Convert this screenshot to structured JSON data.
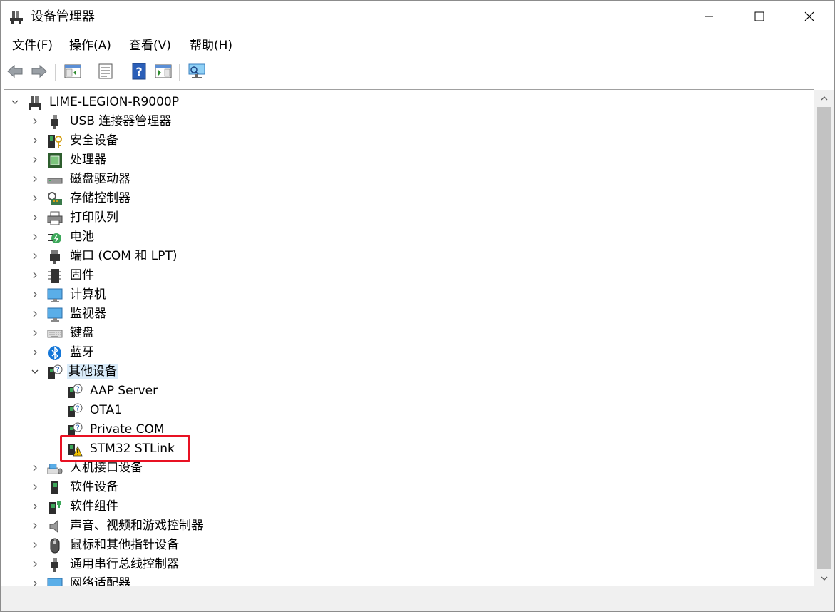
{
  "window": {
    "title": "设备管理器",
    "minimize_icon": "minimize-icon",
    "maximize_icon": "maximize-icon",
    "close_icon": "close-icon"
  },
  "menu": {
    "items": [
      "文件(F)",
      "操作(A)",
      "查看(V)",
      "帮助(H)"
    ]
  },
  "toolbar": {
    "icons": [
      "back-arrow-icon",
      "forward-arrow-icon",
      "show-hide-console-tree-icon",
      "properties-icon",
      "help-icon",
      "action-pane-icon",
      "scan-hardware-icon"
    ]
  },
  "tree": {
    "root": "LIME-LEGION-R9000P",
    "categories": [
      {
        "label": "USB 连接器管理器",
        "icon": "usb-connector-icon"
      },
      {
        "label": "安全设备",
        "icon": "security-device-icon"
      },
      {
        "label": "处理器",
        "icon": "processor-icon"
      },
      {
        "label": "磁盘驱动器",
        "icon": "disk-drive-icon"
      },
      {
        "label": "存储控制器",
        "icon": "storage-controller-icon"
      },
      {
        "label": "打印队列",
        "icon": "printer-icon"
      },
      {
        "label": "电池",
        "icon": "battery-icon"
      },
      {
        "label": "端口 (COM 和 LPT)",
        "icon": "port-icon"
      },
      {
        "label": "固件",
        "icon": "firmware-icon"
      },
      {
        "label": "计算机",
        "icon": "computer-icon"
      },
      {
        "label": "监视器",
        "icon": "monitor-icon"
      },
      {
        "label": "键盘",
        "icon": "keyboard-icon"
      },
      {
        "label": "蓝牙",
        "icon": "bluetooth-icon"
      },
      {
        "label": "其他设备",
        "icon": "unknown-device-icon",
        "expanded": true,
        "selected": true
      }
    ],
    "other_devices": [
      {
        "label": "AAP Server",
        "icon": "unknown-device-icon"
      },
      {
        "label": "OTA1",
        "icon": "unknown-device-icon"
      },
      {
        "label": "Private COM",
        "icon": "unknown-device-icon"
      },
      {
        "label": "STM32 STLink",
        "icon": "warning-device-icon",
        "highlighted": true
      }
    ],
    "categories_after": [
      {
        "label": "人机接口设备",
        "icon": "hid-icon"
      },
      {
        "label": "软件设备",
        "icon": "software-device-icon"
      },
      {
        "label": "软件组件",
        "icon": "software-component-icon"
      },
      {
        "label": "声音、视频和游戏控制器",
        "icon": "speaker-icon"
      },
      {
        "label": "鼠标和其他指针设备",
        "icon": "mouse-icon"
      },
      {
        "label": "通用串行总线控制器",
        "icon": "usb-controller-icon"
      },
      {
        "label": "网络适配器",
        "icon": "network-adapter-icon"
      }
    ]
  },
  "colors": {
    "selection": "#d9ebf9",
    "highlight_box": "#e81123",
    "scrollbar_thumb": "#c2c2c2"
  }
}
